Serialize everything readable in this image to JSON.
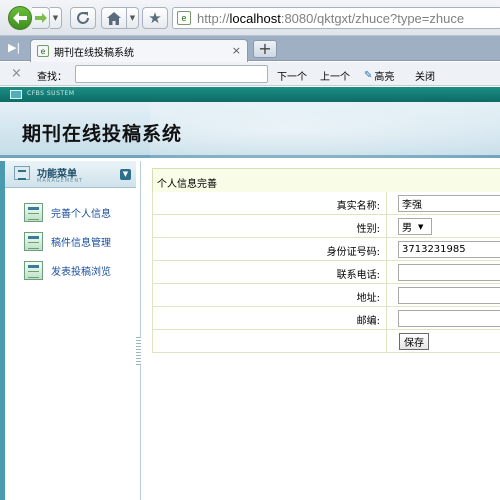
{
  "browser": {
    "url_prefix": "http://",
    "url_host": "localhost",
    "url_rest": ":8080/qktgxt/zhuce?type=zhuce",
    "tab_title": "期刊在线投稿系统",
    "tab_close": "×",
    "new_tab": "+",
    "icons": [
      "back-arrow-icon",
      "forward-arrow-icon",
      "reload-icon",
      "home-icon",
      "bookmark-star-icon",
      "page-icon"
    ]
  },
  "find_bar": {
    "close": "×",
    "label": "查找：",
    "value": "",
    "next": "下一个",
    "prev": "上一个",
    "highlight": "高亮",
    "close_label": "关闭"
  },
  "app": {
    "system_label": "CFBS SUSTEM",
    "title": "期刊在线投稿系统",
    "accent": "#0e6a65"
  },
  "sidebar": {
    "menu_title": "功能菜单",
    "menu_sub": "MANAGEMENT",
    "items": [
      {
        "label": "完善个人信息"
      },
      {
        "label": "稿件信息管理"
      },
      {
        "label": "发表投稿浏览"
      }
    ]
  },
  "form": {
    "header": "个人信息完善",
    "fields": [
      {
        "label": "真实名称:",
        "value": "李强"
      },
      {
        "label": "性别:",
        "value": "男"
      },
      {
        "label": "身份证号码:",
        "value": "3713231985"
      },
      {
        "label": "联系电话:",
        "value": ""
      },
      {
        "label": "地址:",
        "value": ""
      },
      {
        "label": "邮编:",
        "value": ""
      }
    ],
    "submit_label": "保存"
  }
}
